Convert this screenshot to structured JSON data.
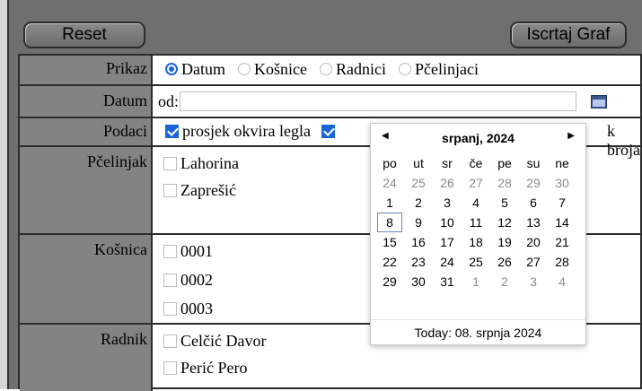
{
  "buttons": {
    "reset": "Reset",
    "draw_graph": "Iscrtaj Graf"
  },
  "rows": {
    "prikaz": {
      "label": "Prikaz",
      "options": [
        "Datum",
        "Košnice",
        "Radnici",
        "Pčelinjaci"
      ],
      "selected_index": 0
    },
    "datum": {
      "label": "Datum",
      "prefix": "od:",
      "input_value": ""
    },
    "podaci": {
      "label": "Podaci",
      "items": [
        {
          "label": "prosjek okvira legla",
          "checked": true
        },
        {
          "label": "",
          "checked": true
        }
      ],
      "right_text": "k broja"
    },
    "pcelinjak": {
      "label": "Pčelinjak",
      "items": [
        "Lahorina",
        "Zaprešić"
      ]
    },
    "kosnica": {
      "label": "Košnica",
      "items": [
        "0001",
        "0002",
        "0003"
      ]
    },
    "radnik": {
      "label": "Radnik",
      "items": [
        "Celčić Davor",
        "Perić Pero"
      ]
    }
  },
  "calendar": {
    "month_year": "srpanj, 2024",
    "weekdays": [
      "po",
      "ut",
      "sr",
      "če",
      "pe",
      "su",
      "ne"
    ],
    "weeks": [
      [
        "24",
        "25",
        "26",
        "27",
        "28",
        "29",
        "30"
      ],
      [
        "1",
        "2",
        "3",
        "4",
        "5",
        "6",
        "7"
      ],
      [
        "8",
        "9",
        "10",
        "11",
        "12",
        "13",
        "14"
      ],
      [
        "15",
        "16",
        "17",
        "18",
        "19",
        "20",
        "21"
      ],
      [
        "22",
        "23",
        "24",
        "25",
        "26",
        "27",
        "28"
      ],
      [
        "29",
        "30",
        "31",
        "1",
        "2",
        "3",
        "4"
      ]
    ],
    "today_text": "Today: 08. srpnja 2024"
  }
}
